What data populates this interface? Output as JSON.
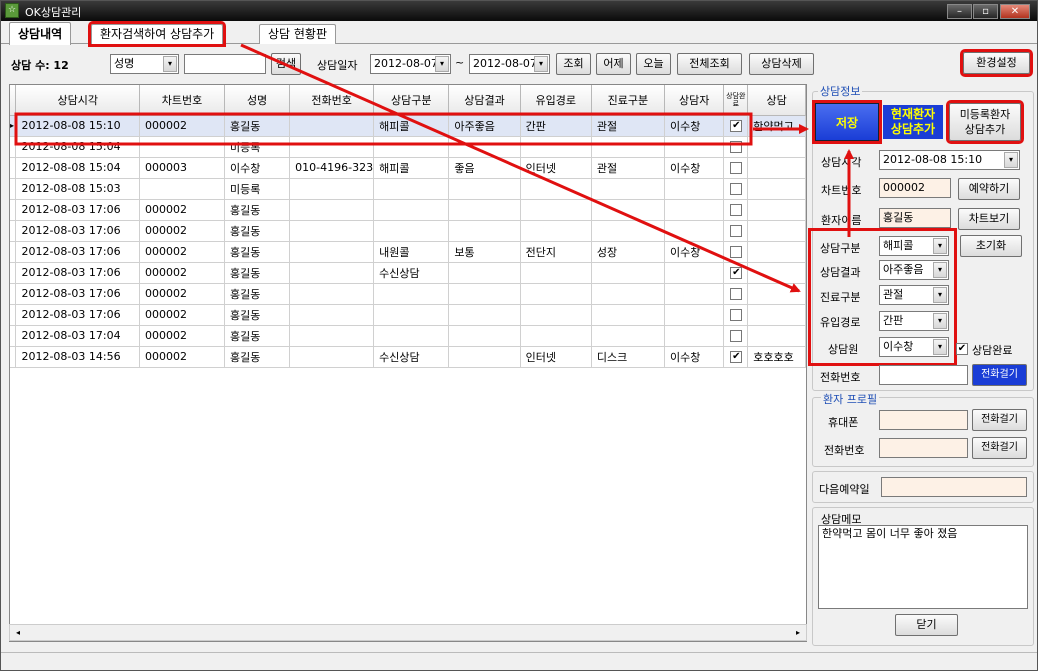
{
  "window": {
    "title": "OK상담관리",
    "app_icon": "☆"
  },
  "tabs": [
    {
      "label": "상담내역"
    },
    {
      "label": "환자검색하여 상담추가"
    },
    {
      "label": "상담 현황판"
    }
  ],
  "toolbar": {
    "count_label": "상담 수: 12",
    "field_select": "성명",
    "search_value": "",
    "search_button": "검색",
    "date_label": "상담일자",
    "date_from": "2012-08-07",
    "tilde": "~",
    "date_to": "2012-08-07",
    "btn_query": "조회",
    "btn_yesterday": "어제",
    "btn_today": "오늘",
    "btn_all": "전체조회",
    "btn_delete": "상담삭제",
    "btn_settings": "환경설정"
  },
  "grid": {
    "columns": [
      "상담시각",
      "차트번호",
      "성명",
      "전화번호",
      "상담구분",
      "상담결과",
      "유입경로",
      "진료구분",
      "상담자",
      "상담완료",
      "상담"
    ],
    "rows": [
      {
        "time": "2012-08-08  15:10",
        "chart": "000002",
        "name": "홍길동",
        "phone": "",
        "type": "해피콜",
        "result": "아주좋음",
        "route": "간판",
        "treat": "관절",
        "staff": "이수창",
        "done": true,
        "memo": "한약먹고"
      },
      {
        "time": "2012-08-08  15:04",
        "chart": "",
        "name": "미등록",
        "phone": "",
        "type": "",
        "result": "",
        "route": "",
        "treat": "",
        "staff": "",
        "done": false,
        "memo": ""
      },
      {
        "time": "2012-08-08  15:04",
        "chart": "000003",
        "name": "이수창",
        "phone": "010-4196-323",
        "type": "해피콜",
        "result": "좋음",
        "route": "인터넷",
        "treat": "관절",
        "staff": "이수창",
        "done": false,
        "memo": ""
      },
      {
        "time": "2012-08-08  15:03",
        "chart": "",
        "name": "미등록",
        "phone": "",
        "type": "",
        "result": "",
        "route": "",
        "treat": "",
        "staff": "",
        "done": false,
        "memo": ""
      },
      {
        "time": "2012-08-03  17:06",
        "chart": "000002",
        "name": "홍길동",
        "phone": "",
        "type": "",
        "result": "",
        "route": "",
        "treat": "",
        "staff": "",
        "done": false,
        "memo": ""
      },
      {
        "time": "2012-08-03  17:06",
        "chart": "000002",
        "name": "홍길동",
        "phone": "",
        "type": "",
        "result": "",
        "route": "",
        "treat": "",
        "staff": "",
        "done": false,
        "memo": ""
      },
      {
        "time": "2012-08-03  17:06",
        "chart": "000002",
        "name": "홍길동",
        "phone": "",
        "type": "내원콜",
        "result": "보통",
        "route": "전단지",
        "treat": "성장",
        "staff": "이수창",
        "done": false,
        "memo": ""
      },
      {
        "time": "2012-08-03  17:06",
        "chart": "000002",
        "name": "홍길동",
        "phone": "",
        "type": "수신상담",
        "result": "",
        "route": "",
        "treat": "",
        "staff": "",
        "done": true,
        "memo": ""
      },
      {
        "time": "2012-08-03  17:06",
        "chart": "000002",
        "name": "홍길동",
        "phone": "",
        "type": "",
        "result": "",
        "route": "",
        "treat": "",
        "staff": "",
        "done": false,
        "memo": ""
      },
      {
        "time": "2012-08-03  17:06",
        "chart": "000002",
        "name": "홍길동",
        "phone": "",
        "type": "",
        "result": "",
        "route": "",
        "treat": "",
        "staff": "",
        "done": false,
        "memo": ""
      },
      {
        "time": "2012-08-03  17:04",
        "chart": "000002",
        "name": "홍길동",
        "phone": "",
        "type": "",
        "result": "",
        "route": "",
        "treat": "",
        "staff": "",
        "done": false,
        "memo": ""
      },
      {
        "time": "2012-08-03  14:56",
        "chart": "000002",
        "name": "홍길동",
        "phone": "",
        "type": "수신상담",
        "result": "",
        "route": "인터넷",
        "treat": "디스크",
        "staff": "이수창",
        "done": true,
        "memo": "호호호호"
      }
    ]
  },
  "panel": {
    "group_label": "상담정보",
    "btn_save": "저장",
    "btn_current_add": "현재환자\n상담추가",
    "btn_unreg_add": "미등록환자\n상담추가",
    "time_label": "상담시각",
    "time_value": "2012-08-08  15:10",
    "chart_label": "차트번호",
    "chart_value": "000002",
    "btn_reserve": "예약하기",
    "patient_label": "환자이름",
    "patient_value": "홍길동",
    "btn_chart": "차트보기",
    "type_label": "상담구분",
    "type_value": "해피콜",
    "btn_reset": "초기화",
    "result_label": "상담결과",
    "result_value": "아주좋음",
    "treat_label": "진료구분",
    "treat_value": "관절",
    "route_label": "유입경로",
    "route_value": "간판",
    "staff_label": "상담원",
    "staff_value": "이수창",
    "done_label": "상담완료",
    "done_checked": "✔",
    "phone_label": "전화번호",
    "phone_value": "",
    "btn_call": "전화걸기",
    "profile_label": "환자 프로필",
    "mobile_label": "휴대폰",
    "mobile_value": "",
    "btn_call_mobile": "전화걸기",
    "tel_label": "전화번호",
    "tel_value": "",
    "btn_call_tel": "전화걸기",
    "next_label": "다음예약일",
    "next_value": "",
    "memo_label": "상담메모",
    "memo_value": "한약먹고 몸이 너무 좋아 졌음",
    "btn_close": "닫기"
  },
  "colors": {
    "accent": "#1a3dd6",
    "highlight": "#e01010",
    "save_text": "#ffff00"
  },
  "icons": {
    "dropdown": "▾",
    "check": "✔",
    "scroll_left": "◂",
    "scroll_right": "▸",
    "row_pointer": "▸"
  }
}
